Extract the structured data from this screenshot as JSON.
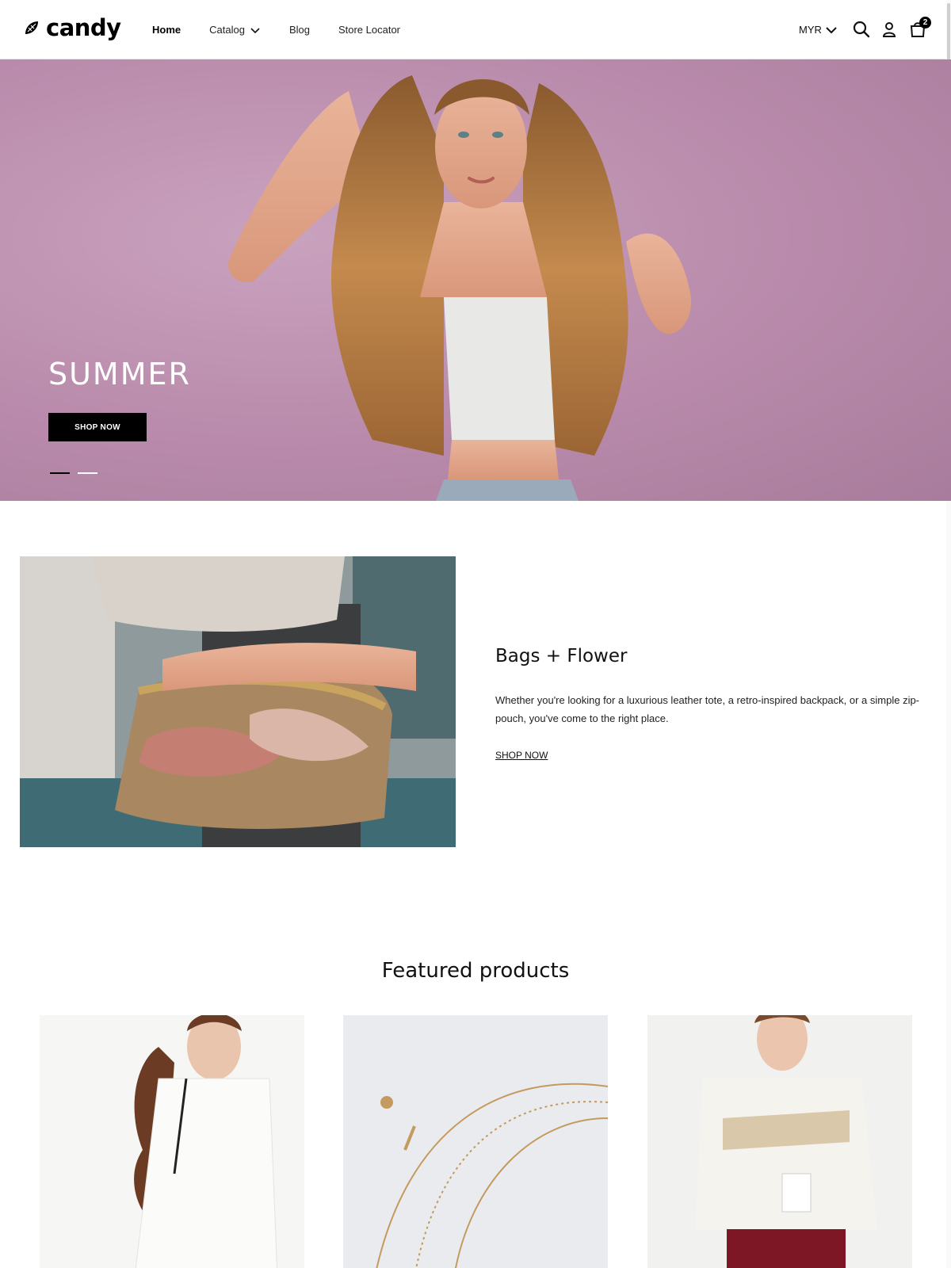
{
  "header": {
    "logo_text": "candy",
    "nav": [
      {
        "label": "Home",
        "active": true
      },
      {
        "label": "Catalog",
        "has_dropdown": true
      },
      {
        "label": "Blog"
      },
      {
        "label": "Store Locator"
      }
    ],
    "currency": "MYR",
    "cart_count": "2",
    "icons": [
      "search-icon",
      "account-icon",
      "cart-icon",
      "chevron-down-icon"
    ]
  },
  "hero": {
    "title": "SUMMER",
    "button_label": "SHOP NOW",
    "slides": 2,
    "active_slide": 1
  },
  "feature": {
    "title": "Bags + Flower",
    "text": "Whether you're looking for a luxurious leather tote, a retro-inspired backpack, or a simple zip-pouch, you've come to the right place.",
    "link_label": "SHOP NOW"
  },
  "featured": {
    "title": "Featured products"
  },
  "colors": {
    "accent": "#000000",
    "hero_bg": "#b98aab",
    "text": "#111111"
  }
}
